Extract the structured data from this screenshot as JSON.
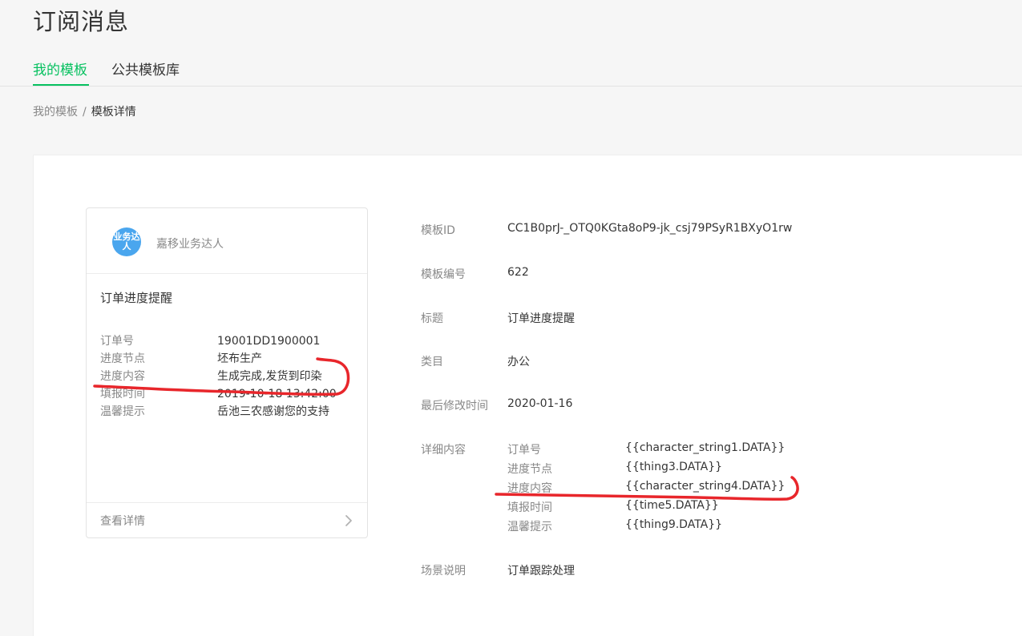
{
  "header": {
    "title": "订阅消息"
  },
  "tabs": [
    {
      "label": "我的模板",
      "active": true
    },
    {
      "label": "公共模板库",
      "active": false
    }
  ],
  "breadcrumb": {
    "parent": "我的模板",
    "separator": "/",
    "current": "模板详情"
  },
  "preview": {
    "avatar_text": "业务达人",
    "account_name": "嘉移业务达人",
    "title": "订单进度提醒",
    "rows": [
      {
        "key": "订单号",
        "value": "19001DD1900001"
      },
      {
        "key": "进度节点",
        "value": "坯布生产"
      },
      {
        "key": "进度内容",
        "value": "生成完成,发货到印染"
      },
      {
        "key": "填报时间",
        "value": "2019-10-18 13:42:00"
      },
      {
        "key": "温馨提示",
        "value": "岳池三农感谢您的支持"
      }
    ],
    "footer_link": "查看详情"
  },
  "details": {
    "template_id_label": "模板ID",
    "template_id": "CC1B0prJ-_OTQ0KGta8oP9-jk_csj79PSyR1BXyO1rw",
    "template_no_label": "模板编号",
    "template_no": "622",
    "title_label": "标题",
    "title": "订单进度提醒",
    "category_label": "类目",
    "category": "办公",
    "modified_label": "最后修改时间",
    "modified": "2020-01-16",
    "content_label": "详细内容",
    "keywords": [
      {
        "key": "订单号",
        "value": "{{character_string1.DATA}}"
      },
      {
        "key": "进度节点",
        "value": "{{thing3.DATA}}"
      },
      {
        "key": "进度内容",
        "value": "{{character_string4.DATA}}"
      },
      {
        "key": "填报时间",
        "value": "{{time5.DATA}}"
      },
      {
        "key": "温馨提示",
        "value": "{{thing9.DATA}}"
      }
    ],
    "scene_label": "场景说明",
    "scene": "订单跟踪处理"
  },
  "colors": {
    "accent": "#07c160",
    "annotation": "#e8262b",
    "muted": "#888888"
  }
}
